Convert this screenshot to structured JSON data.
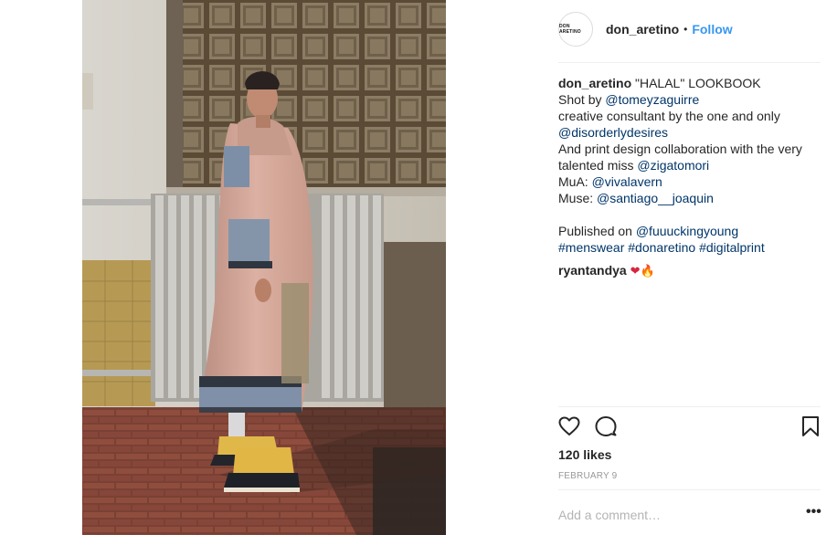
{
  "post": {
    "account": {
      "avatar_text": "DON ARETINO",
      "username": "don_aretino",
      "separator": "•",
      "follow_label": "Follow"
    },
    "caption": {
      "line1_user": "don_aretino",
      "line1_text": " \"HALAL\" LOOKBOOK",
      "shot_by_prefix": "Shot by ",
      "shot_by_handle": "@tomeyzaguirre",
      "consultant_text": "creative consultant by the one and only",
      "consultant_handle": "@disorderlydesires",
      "collab_text_1": "And print design collaboration with the very",
      "collab_text_2": "talented miss ",
      "collab_handle": "@zigatomori",
      "mua_prefix": "MuA: ",
      "mua_handle": "@vivalavern",
      "muse_prefix": "Muse: ",
      "muse_handle": "@santiago__joaquin",
      "published_prefix": "Published on ",
      "published_handle": "@fuuuckingyoung",
      "hashtags": [
        "#menswear",
        "#donaretino",
        "#digitalprint"
      ]
    },
    "comments": [
      {
        "user": "ryantandya",
        "emojis": [
          "❤",
          "🔥"
        ]
      }
    ],
    "actions": {
      "like_icon": "heart-outline-icon",
      "comment_icon": "speech-bubble-icon",
      "save_icon": "bookmark-icon"
    },
    "likes_text": "120 likes",
    "date_text": "FEBRUARY 9",
    "add_comment_placeholder": "Add a comment…",
    "more_label": "•••"
  },
  "colors": {
    "link": "#003569",
    "follow": "#3897f0",
    "text": "#262626",
    "muted": "#999999",
    "divider": "#efefef"
  }
}
